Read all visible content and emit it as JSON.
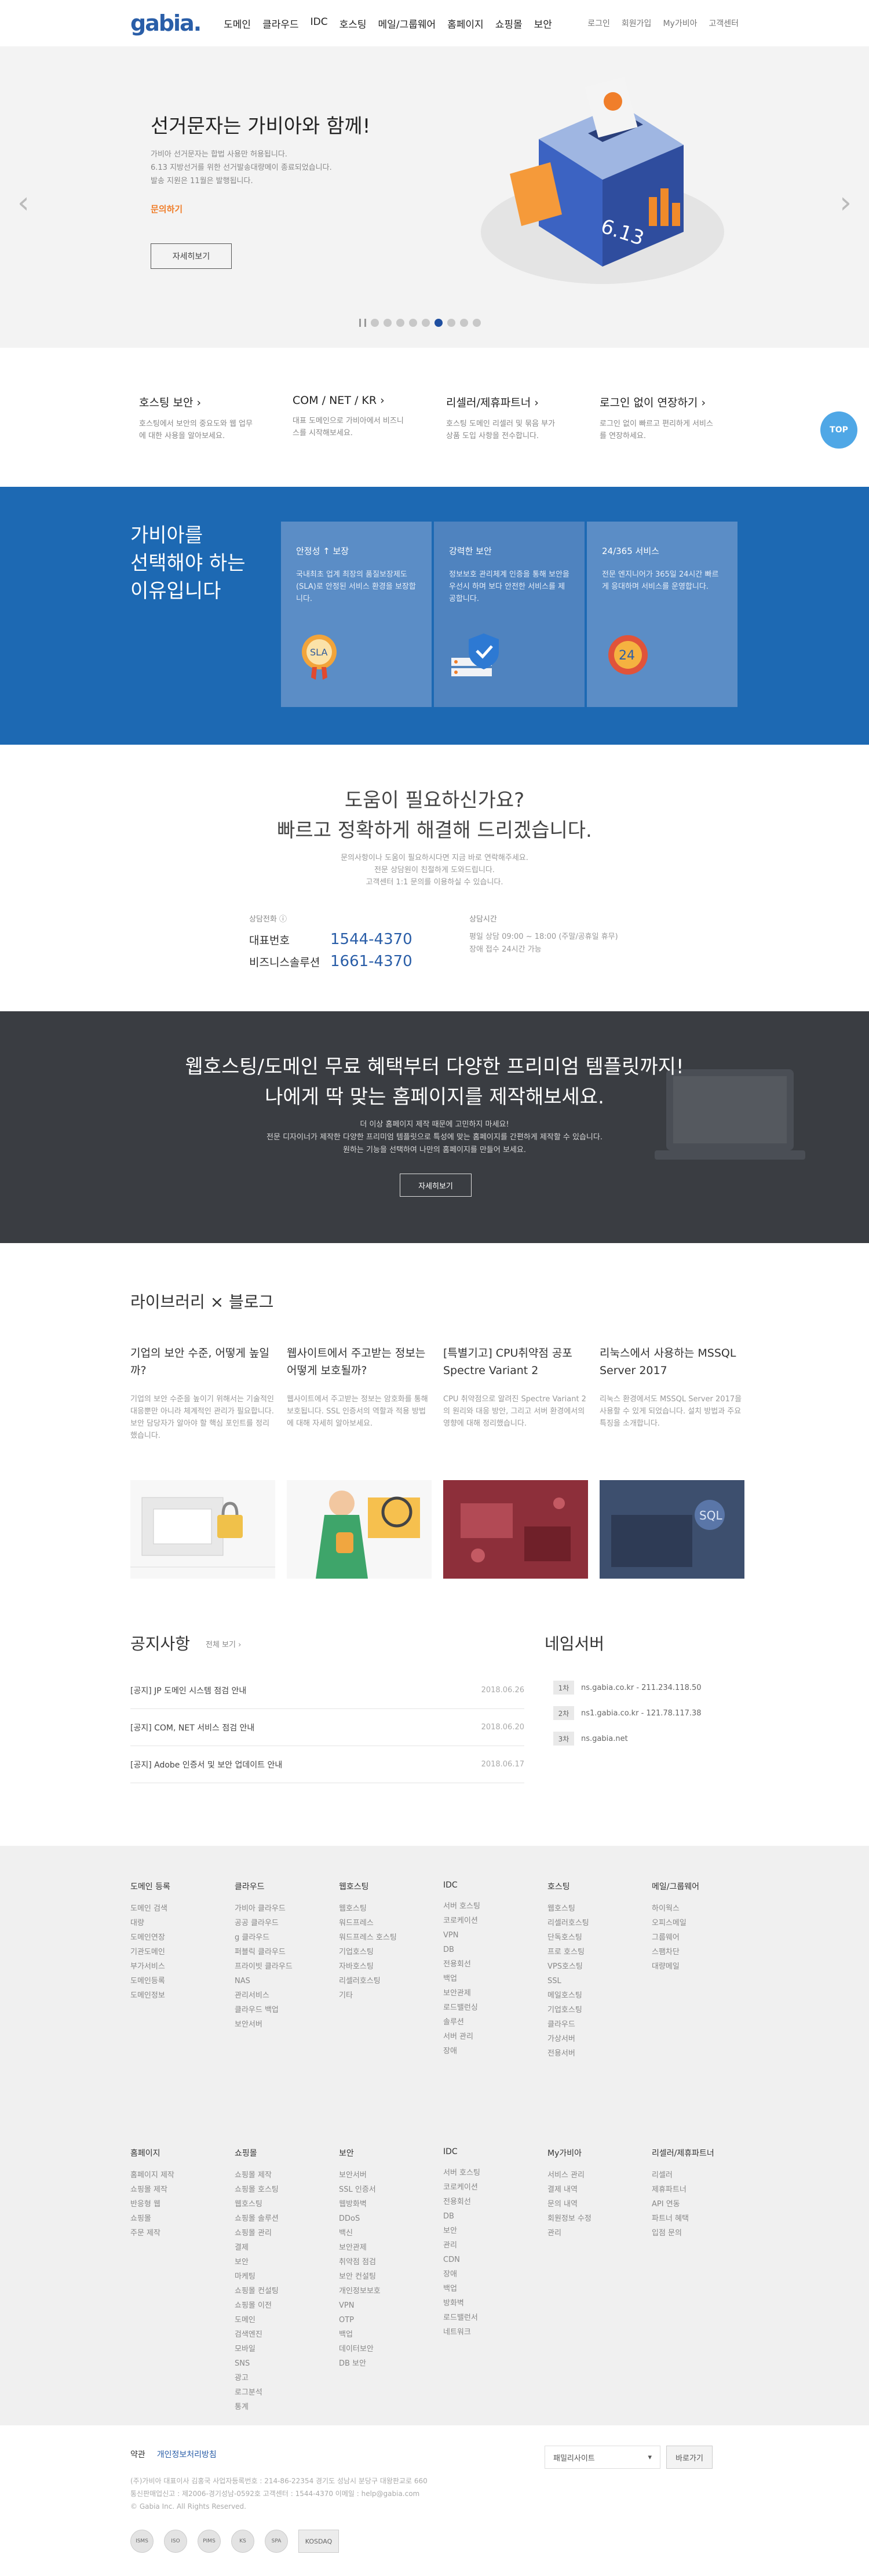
{
  "header": {
    "logo": "gabia.",
    "nav": [
      "도메인",
      "클라우드",
      "IDC",
      "호스팅",
      "메일/그룹웨어",
      "홈페이지",
      "쇼핑몰",
      "보안"
    ],
    "util": [
      "로그인",
      "회원가입",
      "My가비아",
      "고객센터"
    ]
  },
  "hero": {
    "title": "선거문자는 가비아와 함께!",
    "desc_lines": [
      "가비아 선거문자는 합법 사용만 허용됩니다.",
      "6.13 지방선거를 위한 선거발송대량메이 종료되었습니다.",
      "발송 지원은 11월은 발행됩니다."
    ],
    "orange": "문의하기",
    "button": "자세히보기",
    "slides": 9,
    "active_slide": 6
  },
  "quick": {
    "items": [
      {
        "title": "호스팅 보안 ›",
        "desc": "호스팅에서 보안의 중요도와 웹 업무에 대한 사용을 알아보세요."
      },
      {
        "title": "COM / NET / KR ›",
        "desc": "대표 도메인으로 가비아에서 비즈니스를 시작해보세요."
      },
      {
        "title": "리셀러/제휴파트너 ›",
        "desc": "호스팅 도메인 리셀러 및 묶음 부가 상품 도입 사항을 전수합니다."
      },
      {
        "title": "로그인 없이 연장하기 ›",
        "desc": "로그인 없이 빠르고 편리하게 서비스를 연장하세요."
      }
    ],
    "top_label": "TOP"
  },
  "why": {
    "title_lines": [
      "가비아를",
      "선택해야 하는",
      "이유입니다"
    ],
    "cards": [
      {
        "title": "안정성 ↑ 보장",
        "desc": "국내최초 업계 최장의 품질보장제도(SLA)로 안정된 서비스 환경을 보장합니다.",
        "icon": "sla-badge-icon",
        "badge": "SLA"
      },
      {
        "title": "강력한 보안",
        "desc": "정보보호 관리체계 인증을 통해 보안을 우선시 하며 보다 안전한 서비스를 제공합니다.",
        "icon": "shield-server-icon"
      },
      {
        "title": "24/365 서비스",
        "desc": "전문 엔지니어가 365일 24시간 빠르게 응대하며 서비스를 운영합니다.",
        "icon": "support-24-icon",
        "badge": "24"
      }
    ]
  },
  "help": {
    "title_lines": [
      "도움이 필요하신가요?",
      "빠르고 정확하게 해결해 드리겠습니다."
    ],
    "sub_lines": [
      "문의사항이나 도움이 필요하시다면 지금 바로 연락해주세요.",
      "전문 상담원이 친절하게 도와드립니다.",
      "고객센터 1:1 문의를 이용하실 수 있습니다."
    ],
    "left_label": "상담전화 ⓘ",
    "phones": [
      {
        "k": "대표번호",
        "v": "1544-4370"
      },
      {
        "k": "비즈니스솔루션",
        "v": "1661-4370"
      }
    ],
    "right_label": "상담시간",
    "hours": [
      "평일 상담 09:00 ~ 18:00 (주말/공휴일 휴무)",
      "장애 접수 24시간 가능"
    ]
  },
  "webban": {
    "title_lines": [
      "웹호스팅/도메인 무료 혜택부터 다양한 프리미엄 템플릿까지!",
      "나에게 딱 맞는 홈페이지를 제작해보세요."
    ],
    "desc_lines": [
      "더 이상 홈페이지 제작 때문에 고민하지 마세요!",
      "전문 디자이너가 제작한 다양한 프리미엄 템플릿으로 특성에 맞는 홈페이지를 간편하게 제작할 수 있습니다.",
      "원하는 기능을 선택하여 나만의 홈페이지를 만들어 보세요."
    ],
    "button": "자세히보기"
  },
  "library": {
    "title": "라이브러리 × 블로그",
    "cards": [
      {
        "title": "기업의 보안 수준, 어떻게 높일까?",
        "desc": "기업의 보안 수준을 높이기 위해서는 기술적인 대응뿐만 아니라 체계적인 관리가 필요합니다. 보안 담당자가 알아야 할 핵심 포인트를 정리했습니다."
      },
      {
        "title": "웹사이트에서 주고받는 정보는 어떻게 보호될까?",
        "desc": "웹사이트에서 주고받는 정보는 암호화를 통해 보호됩니다. SSL 인증서의 역할과 적용 방법에 대해 자세히 알아보세요."
      },
      {
        "title": "[특별기고] CPU취약점 공포 Spectre Variant 2",
        "desc": "CPU 취약점으로 알려진 Spectre Variant 2의 원리와 대응 방안, 그리고 서버 환경에서의 영향에 대해 정리했습니다."
      },
      {
        "title": "리눅스에서 사용하는 MSSQL Server 2017",
        "desc": "리눅스 환경에서도 MSSQL Server 2017을 사용할 수 있게 되었습니다. 설치 방법과 주요 특징을 소개합니다."
      }
    ]
  },
  "notice": {
    "title": "공지사항",
    "more": "전체 보기 ›",
    "items": [
      {
        "text": "[공지] JP 도메인 시스템 점검 안내",
        "date": "2018.06.26"
      },
      {
        "text": "[공지] COM, NET 서비스 점검 안내",
        "date": "2018.06.20"
      },
      {
        "text": "[공지] Adobe 인증서 및 보안 업데이트 안내",
        "date": "2018.06.17"
      }
    ],
    "ns_title": "네임서버",
    "ns": [
      {
        "badge": "1차",
        "text": "ns.gabia.co.kr - 211.234.118.50"
      },
      {
        "badge": "2차",
        "text": "ns1.gabia.co.kr - 121.78.117.38"
      },
      {
        "badge": "3차",
        "text": "ns.gabia.net"
      }
    ]
  },
  "sitemap": {
    "top": [
      {
        "title": "도메인 등록",
        "items": [
          "도메인 검색",
          "대량",
          "도메인연장",
          "기관도메인",
          "부가서비스",
          "도메인등록",
          "도메인정보"
        ]
      },
      {
        "title": "클라우드",
        "items": [
          "가비아 클라우드",
          "공공 클라우드",
          "g 클라우드",
          "퍼블릭 클라우드",
          "프라이빗 클라우드",
          "NAS",
          "관리서비스",
          "클라우드 백업",
          "보안서버"
        ]
      },
      {
        "title": "웹호스팅",
        "items": [
          "웹호스팅",
          "워드프레스",
          "워드프레스 호스팅",
          "기업호스팅",
          "자바호스팅",
          "리셀러호스팅",
          "기타"
        ]
      },
      {
        "title": "IDC",
        "items": [
          "서버 호스팅",
          "코로케이션",
          "VPN",
          "DB",
          "전용회선",
          "백업",
          "보안관제",
          "로드밸런싱",
          "솔루션",
          "서버 관리",
          "장애"
        ]
      },
      {
        "title": "호스팅",
        "items": [
          "웹호스팅",
          "리셀러호스팅",
          "단독호스팅",
          "프로 호스팅",
          "VPS호스팅",
          "SSL",
          "메일호스팅",
          "기업호스팅",
          "클라우드",
          "가상서버",
          "전용서버"
        ]
      },
      {
        "title": "메일/그룹웨어",
        "items": [
          "하이웍스",
          "오피스메일",
          "그룹웨어",
          "스팸차단",
          "대량메일"
        ]
      }
    ],
    "bottom": [
      {
        "title": "홈페이지",
        "items": [
          "홈페이지 제작",
          "쇼핑몰 제작",
          "반응형 웹",
          "쇼핑몰",
          "주문 제작"
        ]
      },
      {
        "title": "쇼핑몰",
        "items": [
          "쇼핑몰 제작",
          "쇼핑몰 호스팅",
          "웹호스팅",
          "쇼핑몰 솔루션",
          "쇼핑몰 관리",
          "결제",
          "보안",
          "마케팅",
          "쇼핑몰 컨설팅",
          "쇼핑몰 이전",
          "도메인",
          "검색엔진",
          "모바일",
          "SNS",
          "광고",
          "로그분석",
          "통계"
        ]
      },
      {
        "title": "보안",
        "items": [
          "보안서버",
          "SSL 인증서",
          "웹방화벽",
          "DDoS",
          "백신",
          "보안관제",
          "취약점 점검",
          "보안 컨설팅",
          "개인정보보호",
          "VPN",
          "OTP",
          "백업",
          "데이터보안",
          "DB 보안"
        ]
      },
      {
        "title": "IDC",
        "items": [
          "서버 호스팅",
          "코로케이션",
          "전용회선",
          "DB",
          "보안",
          "관리",
          "CDN",
          "장애",
          "백업",
          "방화벽",
          "로드밸런서",
          "네트워크"
        ]
      },
      {
        "title": "My가비아",
        "items": [
          "서비스 관리",
          "결제 내역",
          "문의 내역",
          "회원정보 수정",
          "관리"
        ]
      },
      {
        "title": "리셀러/제휴파트너",
        "items": [
          "리셀러",
          "제휴파트너",
          "API 연동",
          "파트너 혜택",
          "입점 문의"
        ]
      }
    ]
  },
  "footer": {
    "links": [
      "약관",
      "개인정보처리방침"
    ],
    "info_lines": [
      "(주)가비아  대표이사 김홍국  사업자등록번호 : 214-86-22354  경기도 성남시 분당구 대왕판교로 660",
      "통신판매업신고 : 제2006-경기성남-0592호  고객센터 : 1544-4370  이메일 : help@gabia.com",
      "© Gabia Inc. All Rights Reserved."
    ],
    "family_site": "패밀리사이트",
    "go": "바로가기",
    "certs": [
      "ISMS",
      "ISO",
      "PIMS",
      "KS",
      "SPA",
      "KOSDAQ"
    ]
  }
}
